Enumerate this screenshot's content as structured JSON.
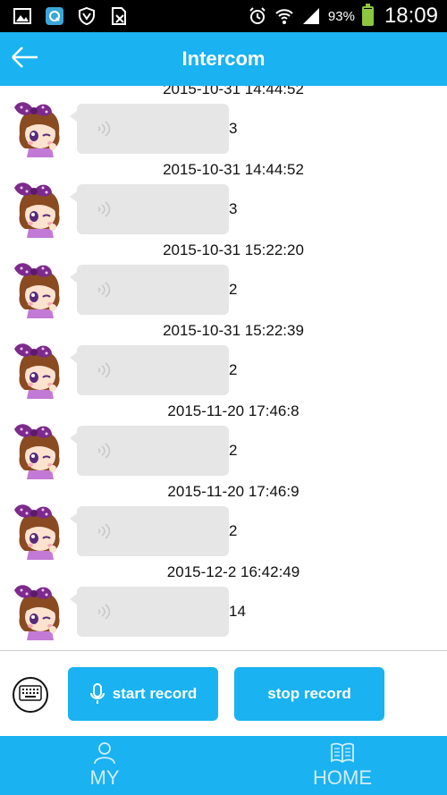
{
  "status_bar": {
    "battery_text": "93%",
    "battery_level": 0.93,
    "time": "18:09",
    "icons": [
      "image-icon",
      "q-app-icon",
      "shield-icon",
      "sim-icon",
      "alarm-icon",
      "wifi-icon",
      "signal-icon",
      "battery-icon"
    ]
  },
  "header": {
    "title": "Intercom",
    "back_icon": "arrow-left-icon"
  },
  "messages": [
    {
      "time": "2015-10-31 14:44:52",
      "duration": "3"
    },
    {
      "time": "2015-10-31 14:44:52",
      "duration": "3"
    },
    {
      "time": "2015-10-31 15:22:20",
      "duration": "2"
    },
    {
      "time": "2015-10-31 15:22:39",
      "duration": "2"
    },
    {
      "time": "2015-11-20 17:46:8",
      "duration": "2"
    },
    {
      "time": "2015-11-20 17:46:9",
      "duration": "2"
    },
    {
      "time": "2015-12-2 16:42:49",
      "duration": "14"
    }
  ],
  "record_bar": {
    "keyboard_icon": "keyboard-icon",
    "start_label": "start record",
    "stop_label": "stop record",
    "mic_icon": "microphone-icon"
  },
  "bottom_nav": {
    "items": [
      {
        "label": "MY",
        "icon": "person-icon"
      },
      {
        "label": "HOME",
        "icon": "book-icon"
      }
    ]
  },
  "colors": {
    "accent": "#1ab2f0",
    "bubble": "#e6e6e6",
    "battery": "#8dc63f"
  }
}
